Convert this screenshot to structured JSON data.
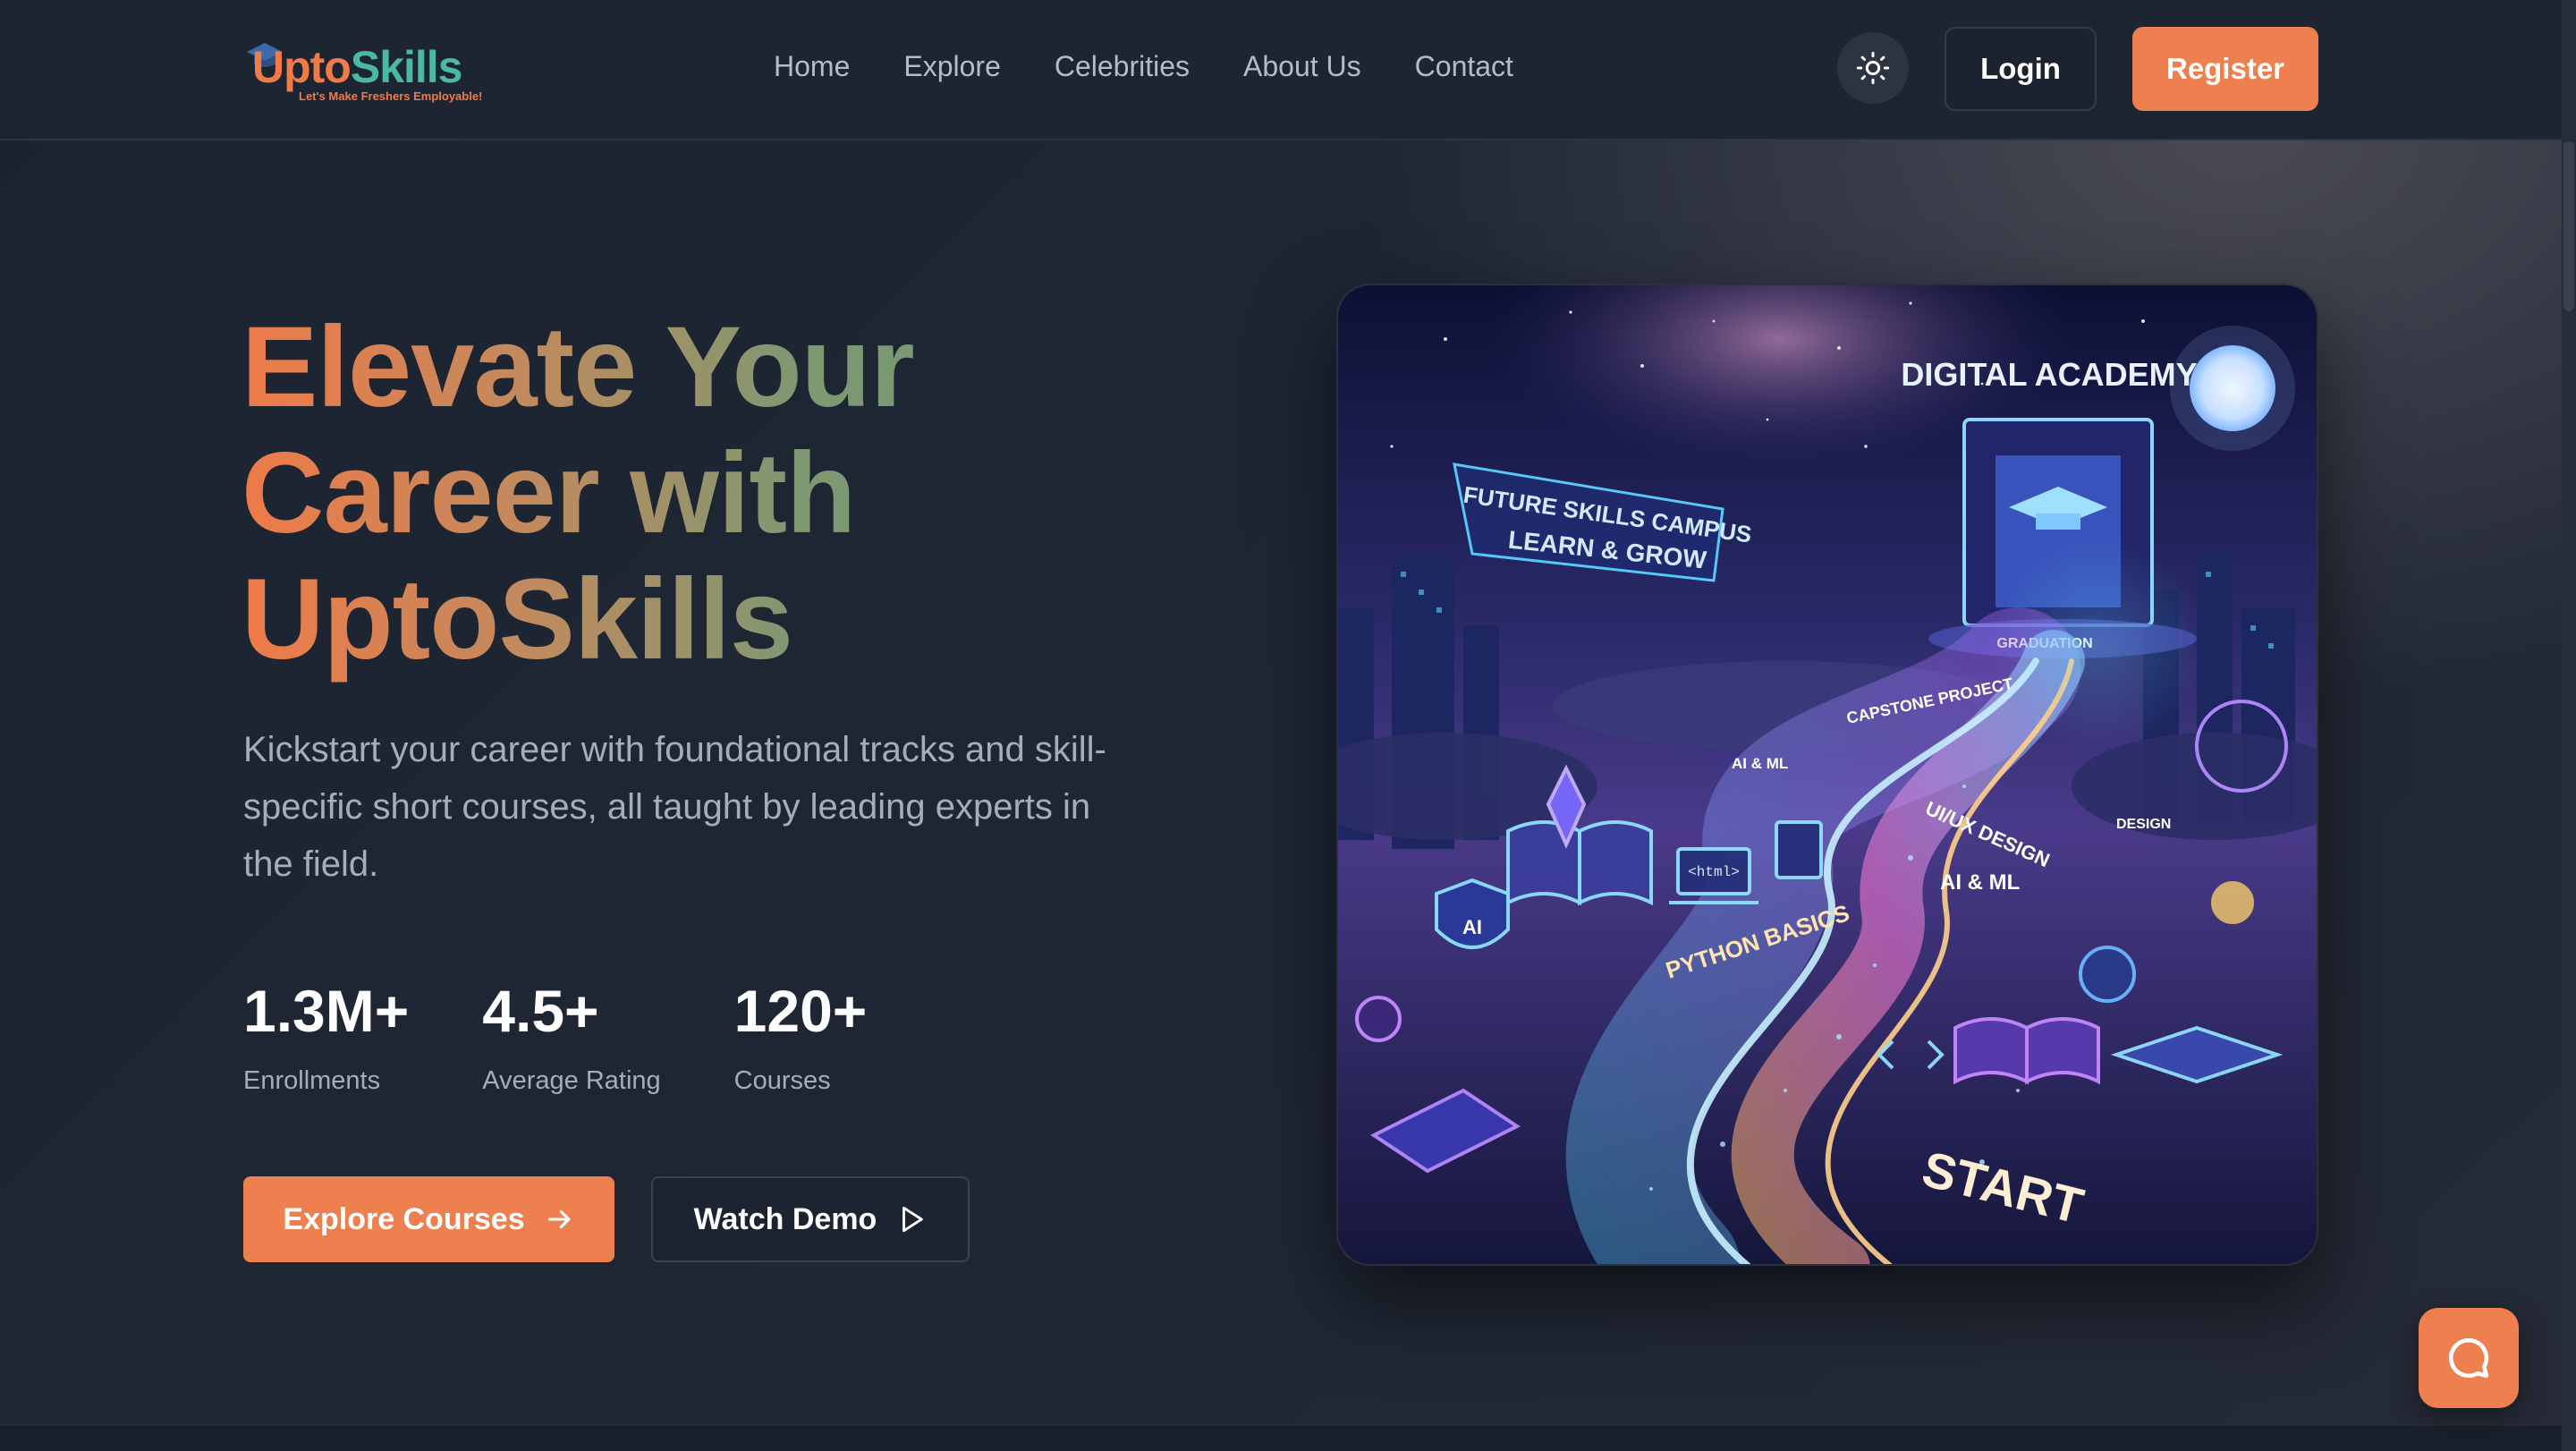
{
  "brand": {
    "logo_upto": "Upto",
    "logo_skills": "Skills",
    "tagline": "Let's Make Freshers Employable!"
  },
  "nav": {
    "links": [
      "Home",
      "Explore",
      "Celebrities",
      "About Us",
      "Contact"
    ],
    "theme_icon": "sun-icon",
    "login_label": "Login",
    "register_label": "Register"
  },
  "hero": {
    "title": "Elevate Your Career with UptoSkills",
    "description": "Kickstart your career with foundational tracks and skill-specific short courses, all taught by leading experts in the field.",
    "stats": [
      {
        "value": "1.3M+",
        "label": "Enrollments"
      },
      {
        "value": "4.5+",
        "label": "Average Rating"
      },
      {
        "value": "120+",
        "label": "Courses"
      }
    ],
    "explore_label": "Explore Courses",
    "demo_label": "Watch Demo"
  },
  "illustration": {
    "labels": {
      "academy": "DIGITAL ACADEMY",
      "campus": "FUTURE SKILLS CAMPUS",
      "learn": "LEARN & GROW",
      "graduation": "GRADUATION",
      "capstone": "CAPSTONE PROJECT",
      "aiml_top": "AI & ML",
      "uiux": "UI/UX DESIGN",
      "design": "DESIGN",
      "aiml": "AI & ML",
      "python": "PYTHON BASICS",
      "start": "START",
      "html": "<html>",
      "ai_badge": "AI"
    }
  },
  "colors": {
    "accent": "#ee7f4e",
    "background": "#1e2533",
    "teal": "#4bb8a0"
  },
  "chat": {
    "icon": "chat-bubble-icon"
  }
}
